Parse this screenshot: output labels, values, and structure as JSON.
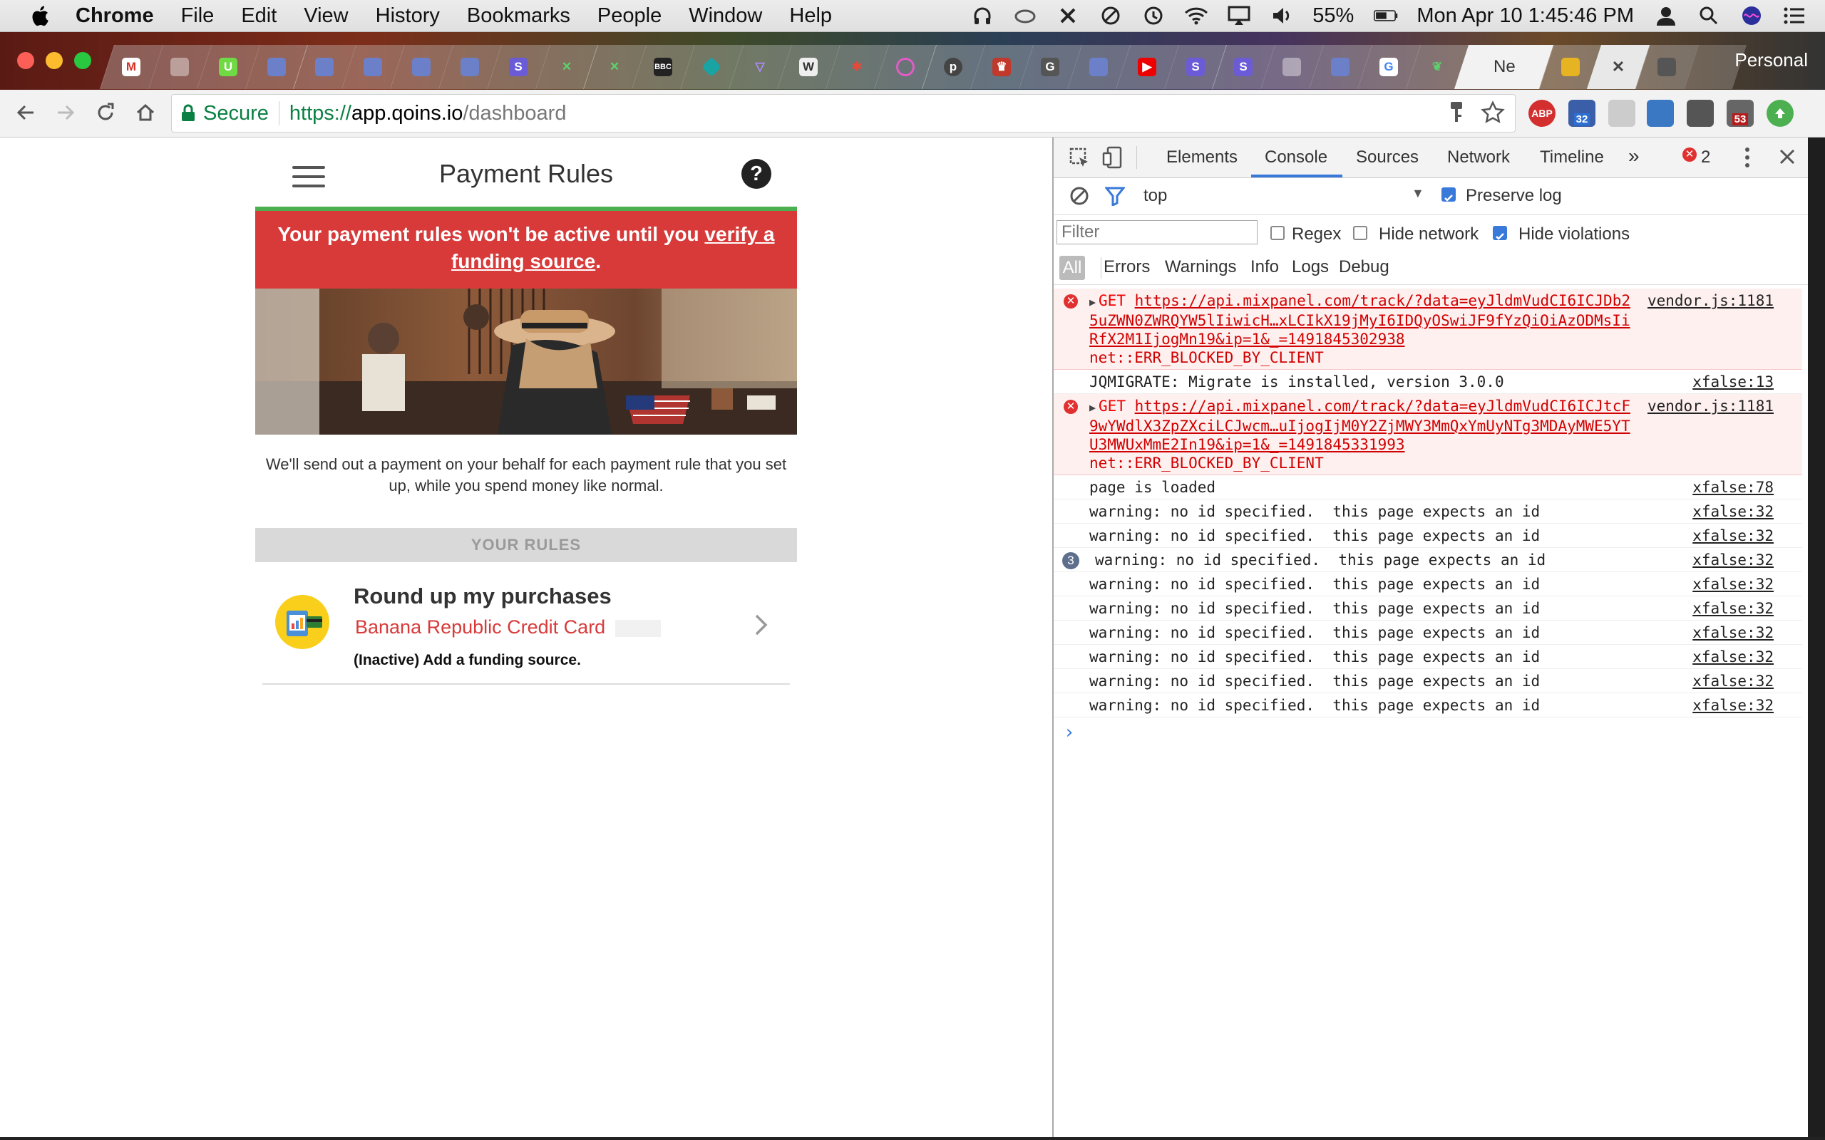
{
  "menubar": {
    "app": "Chrome",
    "items": [
      "File",
      "Edit",
      "View",
      "History",
      "Bookmarks",
      "People",
      "Window",
      "Help"
    ],
    "battery": "55%",
    "clock": "Mon Apr 10  1:45:46 PM"
  },
  "tabs": {
    "active_title": "Ne",
    "profile": "Personal"
  },
  "address": {
    "secure_label": "Secure",
    "scheme": "https://",
    "host": "app.qoins.io",
    "path": "/dashboard"
  },
  "extensions": {
    "abp_label": "ABP",
    "badge_1": "32",
    "badge_2": "53"
  },
  "app": {
    "title": "Payment Rules",
    "help_label": "?",
    "alert_text": "Your payment rules won't be active until you ",
    "alert_link": "verify a funding source",
    "alert_end": ".",
    "description": "We'll send out a payment on your behalf for each payment rule that you set up, while you spend money like normal.",
    "section_label": "YOUR RULES",
    "rule": {
      "title": "Round up my purchases",
      "card": "Banana Republic Credit Card",
      "status": "(Inactive) Add a funding source."
    }
  },
  "devtools": {
    "tabs": [
      "Elements",
      "Console",
      "Sources",
      "Network",
      "Timeline"
    ],
    "more": "»",
    "error_count": "2",
    "context": "top",
    "preserve_log": "Preserve log",
    "filter_placeholder": "Filter",
    "regex": "Regex",
    "hide_network": "Hide network",
    "hide_violations": "Hide violations",
    "levels": [
      "All",
      "Errors",
      "Warnings",
      "Info",
      "Logs",
      "Debug"
    ],
    "logs": [
      {
        "type": "error",
        "method": "GET",
        "url": "https://api.mixpanel.com/track/?data=eyJldmVudCI6ICJDb25uZWN0ZWRQYW5lIiwicH…xLCIkX19jMyI6IDQyOSwiJF9fYzQiOiAzODMsIiRfX2M1IjogMn19&ip=1&_=1491845302938",
        "err": "net::ERR_BLOCKED_BY_CLIENT",
        "src": "vendor.js:1181"
      },
      {
        "type": "log",
        "text": "JQMIGRATE: Migrate is installed, version 3.0.0",
        "src": "xfalse:13"
      },
      {
        "type": "error",
        "method": "GET",
        "url": "https://api.mixpanel.com/track/?data=eyJldmVudCI6ICJtcF9wYWdlX3ZpZXciLCJwcm…uIjogIjM0Y2ZjMWY3MmQxYmUyNTg3MDAyMWE5YTU3MWUxMmE2In19&ip=1&_=1491845331993",
        "err": "net::ERR_BLOCKED_BY_CLIENT",
        "src": "vendor.js:1181"
      },
      {
        "type": "log",
        "text": "page is loaded",
        "src": "xfalse:78"
      },
      {
        "type": "log",
        "text": "warning: no id specified.  this page expects an id",
        "src": "xfalse:32"
      },
      {
        "type": "log",
        "text": "warning: no id specified.  this page expects an id",
        "src": "xfalse:32"
      },
      {
        "type": "log",
        "count": "3",
        "text": "warning: no id specified.  this page expects an id",
        "src": "xfalse:32"
      },
      {
        "type": "log",
        "text": "warning: no id specified.  this page expects an id",
        "src": "xfalse:32"
      },
      {
        "type": "log",
        "text": "warning: no id specified.  this page expects an id",
        "src": "xfalse:32"
      },
      {
        "type": "log",
        "text": "warning: no id specified.  this page expects an id",
        "src": "xfalse:32"
      },
      {
        "type": "log",
        "text": "warning: no id specified.  this page expects an id",
        "src": "xfalse:32"
      },
      {
        "type": "log",
        "text": "warning: no id specified.  this page expects an id",
        "src": "xfalse:32"
      },
      {
        "type": "log",
        "text": "warning: no id specified.  this page expects an id",
        "src": "xfalse:32"
      }
    ],
    "prompt": "›"
  },
  "colors": {
    "alert_red": "#d83a3a",
    "alert_border_green": "#4caf50",
    "secure_green": "#0b8043",
    "devtools_blue": "#3879d9"
  }
}
